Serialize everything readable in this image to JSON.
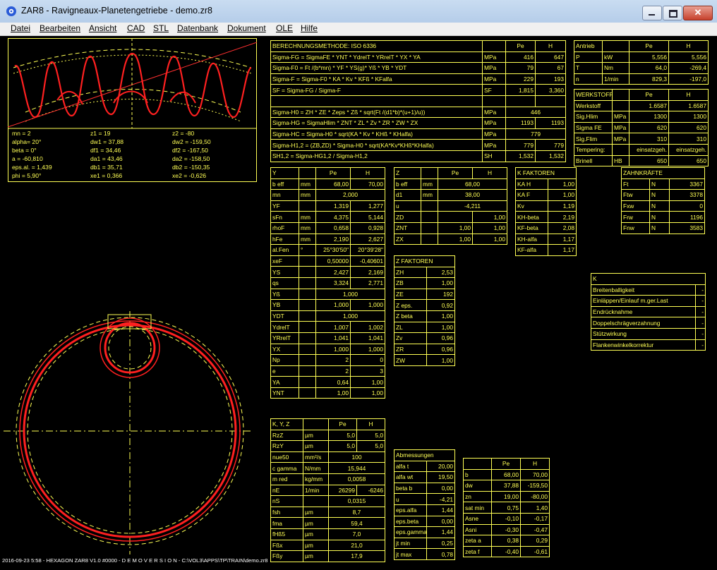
{
  "window": {
    "title": "ZAR8 - Ravigneaux-Planetengetriebe  -  demo.zr8"
  },
  "menu": [
    "Datei",
    "Bearbeiten",
    "Ansicht",
    "CAD",
    "STL",
    "Datenbank",
    "Dokument",
    "OLE",
    "Hilfe"
  ],
  "preview_params": [
    [
      "mn = 2",
      "z1 = 19",
      "z2 = -80"
    ],
    [
      "alpha= 20°",
      "dw1 = 37,88",
      "dw2 = -159,50"
    ],
    [
      "beta = 0°",
      "df1 = 34,46",
      "df2 = -167,50"
    ],
    [
      "a = -60,810",
      "da1 = 43,46",
      "da2 = -158,50"
    ],
    [
      "eps.al. = 1,439",
      "db1 = 35,71",
      "db2 = -150,35"
    ],
    [
      "phi = 5,90°",
      "xe1 = 0,366",
      "xe2 = -0,626"
    ]
  ],
  "calc_table": {
    "header": [
      "BERECHNUNGSMETHODE:  ISO 6336",
      "",
      "Pe",
      "H"
    ],
    "rows": [
      [
        "Sigma-FG = SigmaFE * YNT * YdrelT * YRrelT * YX * YA",
        "MPa",
        "416",
        "647"
      ],
      [
        "Sigma-F0 = Ft /(b*mn) * YF * YS(g)* Yß * YB * YDT",
        "MPa",
        "79",
        "67"
      ],
      [
        "Sigma-F = Sigma-F0 * KA * Kv * KFß * KFalfa",
        "MPa",
        "229",
        "193"
      ],
      [
        "SF = Sigma-FG / Sigma-F",
        "SF",
        "1,815",
        "3,360"
      ],
      [
        "",
        "",
        "",
        ""
      ],
      [
        "Sigma-H0 = ZH * ZE * Zeps * Zß * sqrt(Ft /(d1*b)*(u+1)/u))",
        "MPa",
        "446",
        ""
      ],
      [
        "Sigma-HG = SigmaHlim * ZNT * ZL * Zv * ZR * ZW * ZX",
        "MPa",
        "1193",
        "1193"
      ],
      [
        "Sigma-HC = Sigma-H0 * sqrt(KA * Kv * KHß * KHalfa)",
        "MPa",
        "779",
        ""
      ],
      [
        "Sigma-H1,2 = (ZB,ZD) * Sigma-H0 * sqrt(KA*Kv*KHß*KHalfa)",
        "MPa",
        "779",
        "779"
      ],
      [
        "SH1,2 = Sigma-HG1,2 / Sigma-H1,2",
        "SH",
        "1,532",
        "1,532"
      ]
    ]
  },
  "antrieb": {
    "header": [
      "Antrieb",
      "",
      "Pe",
      "H"
    ],
    "rows": [
      [
        "P",
        "kW",
        "5,556",
        "5,556"
      ],
      [
        "T",
        "Nm",
        "64,0",
        "-269,4"
      ],
      [
        "n",
        "1/min",
        "829,3",
        "-197,0"
      ]
    ]
  },
  "werkstoff": {
    "header": [
      "WERKSTOFF",
      "",
      "Pe",
      "H"
    ],
    "rows": [
      [
        "Werkstoff",
        "",
        "1.6587",
        "1.6587"
      ],
      [
        "Sig.Hlim",
        "MPa",
        "1300",
        "1300"
      ],
      [
        "Sigma FE",
        "MPa",
        "620",
        "620"
      ],
      [
        "Sig.Flim",
        "MPa",
        "310",
        "310"
      ],
      [
        "Tempering:",
        "",
        "einsatzgeh.",
        "einsatzgeh."
      ],
      [
        "Brinell",
        "HB",
        "650",
        "650"
      ]
    ]
  },
  "y_table": {
    "header": [
      "Y",
      "",
      "Pe",
      "H"
    ],
    "rows": [
      [
        "b eff",
        "mm",
        "68,00",
        "70,00"
      ],
      [
        "mn",
        "mm",
        "2,000",
        ""
      ],
      [
        "YF",
        "",
        "1,319",
        "1,277"
      ],
      [
        "sFn",
        "mm",
        "4,375",
        "5,144"
      ],
      [
        "rhoF",
        "mm",
        "0,658",
        "0,928"
      ],
      [
        "hFe",
        "mm",
        "2,190",
        "2,627"
      ],
      [
        "al.Fen",
        "°",
        "25°30'50\"",
        "20°39'28\""
      ],
      [
        "xeF",
        "",
        "0,50000",
        "-0,40601"
      ],
      [
        "YS",
        "",
        "2,427",
        "2,169"
      ],
      [
        "qs",
        "",
        "3,324",
        "2,771"
      ],
      [
        "Yß",
        "",
        "1,000",
        ""
      ],
      [
        "YB",
        "",
        "1,000",
        "1,000"
      ],
      [
        "YDT",
        "",
        "1,000",
        ""
      ],
      [
        "YdrelT",
        "",
        "1,007",
        "1,002"
      ],
      [
        "YRrelT",
        "",
        "1,041",
        "1,041"
      ],
      [
        "YX",
        "",
        "1,000",
        "1,000"
      ],
      [
        "Np",
        "",
        "2",
        "0"
      ],
      [
        "e",
        "",
        "2",
        "3"
      ],
      [
        "YA",
        "",
        "0,64",
        "1,00"
      ],
      [
        "YNT",
        "",
        "1,00",
        "1,00"
      ]
    ]
  },
  "z_table": {
    "header": [
      "Z",
      "",
      "Pe",
      "H"
    ],
    "rows": [
      [
        "b eff",
        "mm",
        "68,00",
        ""
      ],
      [
        "d1",
        "mm",
        "38,00",
        ""
      ],
      [
        "u",
        "",
        "-4,211",
        ""
      ],
      [
        "ZD",
        "",
        "",
        "1,00"
      ],
      [
        "ZNT",
        "",
        "1,00",
        "1,00"
      ],
      [
        "ZX",
        "",
        "1,00",
        "1,00"
      ]
    ]
  },
  "z_faktoren": {
    "header": "Z FAKTOREN",
    "rows": [
      [
        "ZH",
        "2,53"
      ],
      [
        "ZB",
        "1,00"
      ],
      [
        "ZE",
        "192"
      ],
      [
        "Z eps.",
        "0,92"
      ],
      [
        "Z beta",
        "1,00"
      ],
      [
        "ZL",
        "1,00"
      ],
      [
        "Zv",
        "0,96"
      ],
      [
        "ZR",
        "0,96"
      ],
      [
        "ZW",
        "1,00"
      ]
    ]
  },
  "k_faktoren": {
    "header": "K FAKTOREN",
    "rows": [
      [
        "KA H",
        "1,00"
      ],
      [
        "KA F",
        "1,00"
      ],
      [
        "Kv",
        "1,19"
      ],
      [
        "KH-beta",
        "2,19"
      ],
      [
        "KF-beta",
        "2,08"
      ],
      [
        "KH-alfa",
        "1,17"
      ],
      [
        "KF-alfa",
        "1,17"
      ]
    ]
  },
  "zahnkraefte": {
    "header": "ZAHNKRÄFTE",
    "rows": [
      [
        "Ft",
        "N",
        "3367"
      ],
      [
        "Ftw",
        "N",
        "3378"
      ],
      [
        "Fxw",
        "N",
        "0"
      ],
      [
        "Frw",
        "N",
        "1196"
      ],
      [
        "Fnw",
        "N",
        "3583"
      ]
    ]
  },
  "k_table": {
    "header": "K",
    "rows": [
      [
        "Breitenballigkeit",
        "-"
      ],
      [
        "Einläppen/Einlauf m.ger.Last",
        "-"
      ],
      [
        "Endrücknahme",
        "-"
      ],
      [
        "Doppelschrägverzahnung",
        "-"
      ],
      [
        "Stützwirkung",
        "-"
      ],
      [
        "Flankenwinkelkorrektur",
        "-"
      ]
    ]
  },
  "kyz_table": {
    "header": [
      "K, Y, Z",
      "",
      "Pe",
      "H"
    ],
    "rows": [
      [
        "RzZ",
        "µm",
        "5,0",
        "5,0"
      ],
      [
        "RzY",
        "µm",
        "5,0",
        "5,0"
      ],
      [
        "nue50",
        "mm²/s",
        "100",
        ""
      ],
      [
        "c gamma",
        "N/mm",
        "15,944",
        ""
      ],
      [
        "m red",
        "kg/mm",
        "0,0058",
        ""
      ],
      [
        "nE",
        "1/min",
        "26299",
        "-6246"
      ],
      [
        "nS",
        "",
        "0,0315",
        ""
      ],
      [
        "fsh",
        "µm",
        "8,7",
        ""
      ],
      [
        "fma",
        "µm",
        "59,4",
        ""
      ],
      [
        "fHß5",
        "µm",
        "7,0",
        ""
      ],
      [
        "Fßx",
        "µm",
        "21,0",
        ""
      ],
      [
        "Fßy",
        "µm",
        "17,9",
        ""
      ]
    ]
  },
  "abmessungen": {
    "header": "Abmessungen",
    "rows": [
      [
        "alfa t",
        "20,00"
      ],
      [
        "alfa wt",
        "19,50"
      ],
      [
        "beta b",
        "0,00"
      ],
      [
        "u",
        "-4,21"
      ],
      [
        "eps.alfa",
        "1,44"
      ],
      [
        "eps.beta",
        "0,00"
      ],
      [
        "eps.gamma",
        "1,44"
      ],
      [
        "jt min",
        "0,25"
      ],
      [
        "jt max",
        "0,78"
      ]
    ]
  },
  "dims_table": {
    "header": [
      "",
      "Pe",
      "H"
    ],
    "rows": [
      [
        "b",
        "68,00",
        "70,00"
      ],
      [
        "dw",
        "37,88",
        "-159,50"
      ],
      [
        "zn",
        "19,00",
        "-80,00"
      ],
      [
        "sat min",
        "0,75",
        "1,40"
      ],
      [
        "Asne",
        "-0,10",
        "-0,17"
      ],
      [
        "Asni",
        "-0,30",
        "-0,47"
      ],
      [
        "zeta a",
        "0,38",
        "0,29"
      ],
      [
        "zeta f",
        "-0,40",
        "-0,61"
      ]
    ]
  },
  "status": "2016-09-23 5:58 - HEXAGON ZAR8 V1.0 #0000 - D E M O V E R S I O N - C:\\VOL3\\APPS\\TP\\TRAIN\\demo.zr8",
  "colors": {
    "background": "#000000",
    "table_text": "#ffff55",
    "gear_outline": "#ff2020",
    "center_line": "#ffff55"
  }
}
